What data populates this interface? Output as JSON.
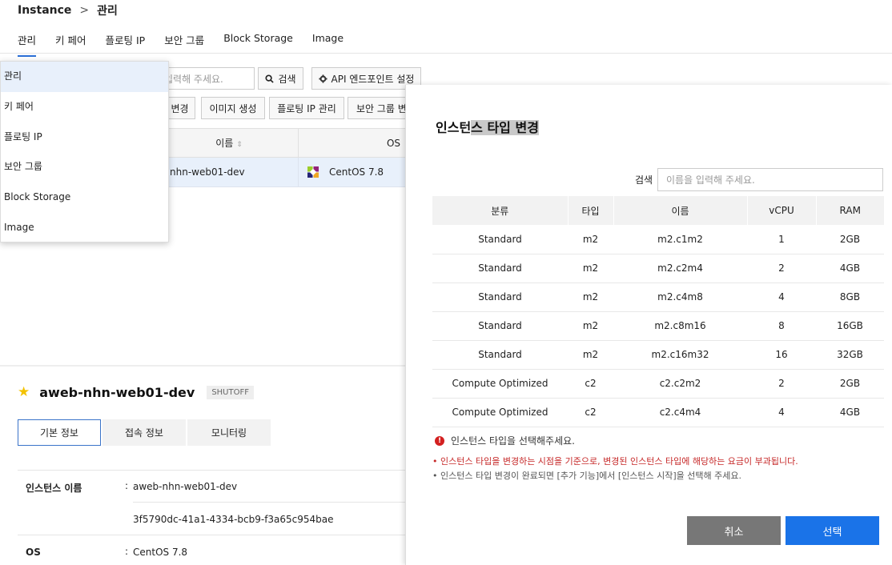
{
  "breadcrumb": {
    "root": "Instance",
    "sep": ">",
    "current": "관리"
  },
  "tabs": [
    "관리",
    "키 페어",
    "플로팅 IP",
    "보안 그룹",
    "Block Storage",
    "Image"
  ],
  "toolbar": {
    "search_placeholder": "입력해 주세요.",
    "search_button": "검색",
    "api_button": "API 엔드포인트 설정",
    "row2": [
      "변경",
      "이미지 생성",
      "플로팅 IP 관리",
      "보안 그룹 변"
    ]
  },
  "table": {
    "headers": {
      "name": "이름",
      "os": "OS"
    },
    "row": {
      "name": "nhn-web01-dev",
      "os": "CentOS 7.8"
    }
  },
  "dropdown": [
    "관리",
    "키 페어",
    "플로팅 IP",
    "보안 그룹",
    "Block Storage",
    "Image"
  ],
  "detail": {
    "name": "aweb-nhn-web01-dev",
    "status": "SHUTOFF",
    "tabs": [
      "기본 정보",
      "접속 정보",
      "모니터링"
    ],
    "rows": [
      {
        "key": "인스턴스 이름",
        "colon": ":",
        "value": "aweb-nhn-web01-dev"
      },
      {
        "key": "",
        "colon": "",
        "value": "3f5790dc-41a1-4334-bcb9-f3a65c954bae"
      },
      {
        "key": "OS",
        "colon": ":",
        "value": "CentOS 7.8"
      }
    ]
  },
  "modal": {
    "title_part1": "인스턴",
    "title_part2": "스 타입 변경",
    "search_label": "검색",
    "search_placeholder": "이름을 입력해 주세요.",
    "columns": [
      "분류",
      "타입",
      "이름",
      "vCPU",
      "RAM"
    ],
    "rows": [
      [
        "Standard",
        "m2",
        "m2.c1m2",
        "1",
        "2GB"
      ],
      [
        "Standard",
        "m2",
        "m2.c2m4",
        "2",
        "4GB"
      ],
      [
        "Standard",
        "m2",
        "m2.c4m8",
        "4",
        "8GB"
      ],
      [
        "Standard",
        "m2",
        "m2.c8m16",
        "8",
        "16GB"
      ],
      [
        "Standard",
        "m2",
        "m2.c16m32",
        "16",
        "32GB"
      ],
      [
        "Compute Optimized",
        "c2",
        "c2.c2m2",
        "2",
        "2GB"
      ],
      [
        "Compute Optimized",
        "c2",
        "c2.c4m4",
        "4",
        "4GB"
      ]
    ],
    "error": "인스턴스 타입을 선택해주세요.",
    "note_red": "인스턴스 타입을 변경하는 시점을 기준으로, 변경된 인스턴스 타입에 해당하는 요금이 부과됩니다.",
    "note_gray": "인스턴스 타입 변경이 완료되면 [추가 기능]에서 [인스턴스 시작]을 선택해 주세요.",
    "cancel": "취소",
    "confirm": "선택",
    "colors": {
      "cancel": "#777777",
      "confirm": "#1a73e8"
    }
  }
}
